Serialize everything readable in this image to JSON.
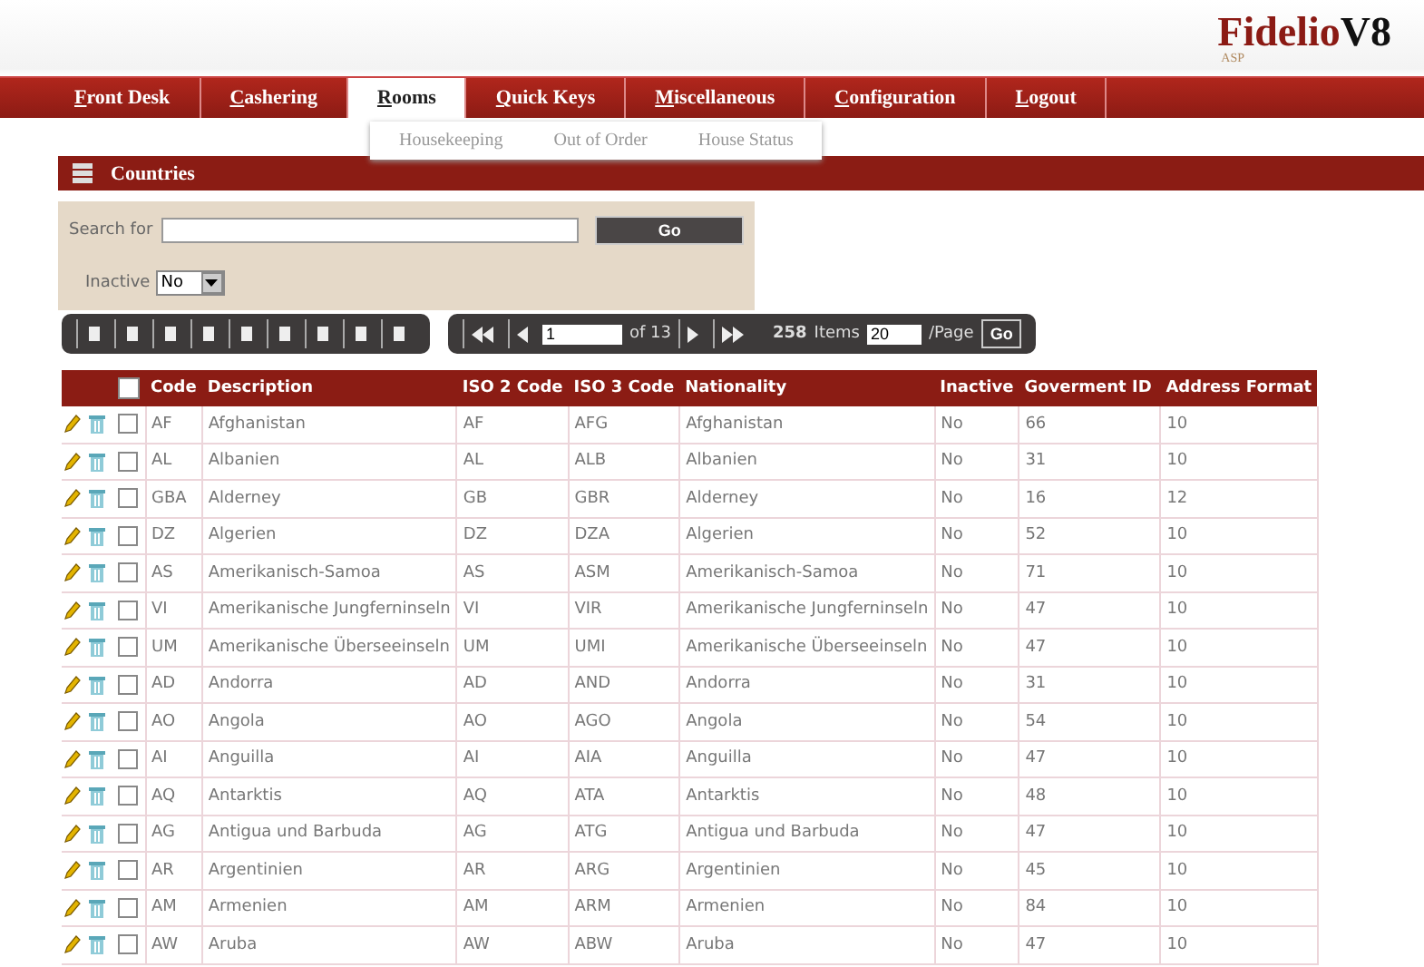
{
  "logo": {
    "name": "Fidelio",
    "version": "V8",
    "sub": "ASP"
  },
  "nav": [
    {
      "label": "Front Desk",
      "selected": false
    },
    {
      "label": "Cashering",
      "selected": false
    },
    {
      "label": "Rooms",
      "selected": true
    },
    {
      "label": "Quick Keys",
      "selected": false
    },
    {
      "label": "Miscellaneous",
      "selected": false
    },
    {
      "label": "Configuration",
      "selected": false
    },
    {
      "label": "Logout",
      "selected": false
    }
  ],
  "submenu": [
    "Housekeeping",
    "Out of Order",
    "House Status"
  ],
  "panel_title": "Countries",
  "search": {
    "label": "Search for",
    "button": "Go",
    "inactive_label": "Inactive",
    "inactive_value": "No"
  },
  "pager": {
    "page": "1",
    "of": "of 13",
    "count": "258",
    "items": "Items",
    "per_page": "20",
    "per_page_label": "/Page",
    "button": "Go"
  },
  "table": {
    "header_checked": false,
    "columns": [
      "Code",
      "Description",
      "ISO 2 Code",
      "ISO 3 Code",
      "Nationality",
      "Inactive",
      "Goverment ID",
      "Address Format"
    ],
    "rows": [
      {
        "checked": false,
        "cells": [
          "AF",
          "Afghanistan",
          "AF",
          "AFG",
          "Afghanistan",
          "No",
          "66",
          "10"
        ]
      },
      {
        "checked": false,
        "cells": [
          "AL",
          "Albanien",
          "AL",
          "ALB",
          "Albanien",
          "No",
          "31",
          "10"
        ]
      },
      {
        "checked": false,
        "cells": [
          "GBA",
          "Alderney",
          "GB",
          "GBR",
          "Alderney",
          "No",
          "16",
          "12"
        ]
      },
      {
        "checked": false,
        "cells": [
          "DZ",
          "Algerien",
          "DZ",
          "DZA",
          "Algerien",
          "No",
          "52",
          "10"
        ]
      },
      {
        "checked": false,
        "cells": [
          "AS",
          "Amerikanisch-Samoa",
          "AS",
          "ASM",
          "Amerikanisch-Samoa",
          "No",
          "71",
          "10"
        ]
      },
      {
        "checked": false,
        "cells": [
          "VI",
          "Amerikanische Jungferninseln",
          "VI",
          "VIR",
          "Amerikanische Jungferninseln",
          "No",
          "47",
          "10"
        ]
      },
      {
        "checked": false,
        "cells": [
          "UM",
          "Amerikanische Überseeinseln",
          "UM",
          "UMI",
          "Amerikanische Überseeinseln",
          "No",
          "47",
          "10"
        ]
      },
      {
        "checked": false,
        "cells": [
          "AD",
          "Andorra",
          "AD",
          "AND",
          "Andorra",
          "No",
          "31",
          "10"
        ]
      },
      {
        "checked": false,
        "cells": [
          "AO",
          "Angola",
          "AO",
          "AGO",
          "Angola",
          "No",
          "54",
          "10"
        ]
      },
      {
        "checked": false,
        "cells": [
          "AI",
          "Anguilla",
          "AI",
          "AIA",
          "Anguilla",
          "No",
          "47",
          "10"
        ]
      },
      {
        "checked": false,
        "cells": [
          "AQ",
          "Antarktis",
          "AQ",
          "ATA",
          "Antarktis",
          "No",
          "48",
          "10"
        ]
      },
      {
        "checked": false,
        "cells": [
          "AG",
          "Antigua und Barbuda",
          "AG",
          "ATG",
          "Antigua und Barbuda",
          "No",
          "47",
          "10"
        ]
      },
      {
        "checked": false,
        "cells": [
          "AR",
          "Argentinien",
          "AR",
          "ARG",
          "Argentinien",
          "No",
          "45",
          "10"
        ]
      },
      {
        "checked": false,
        "cells": [
          "AM",
          "Armenien",
          "AM",
          "ARM",
          "Armenien",
          "No",
          "84",
          "10"
        ]
      },
      {
        "checked": false,
        "cells": [
          "AW",
          "Aruba",
          "AW",
          "ABW",
          "Aruba",
          "No",
          "47",
          "10"
        ]
      }
    ]
  }
}
